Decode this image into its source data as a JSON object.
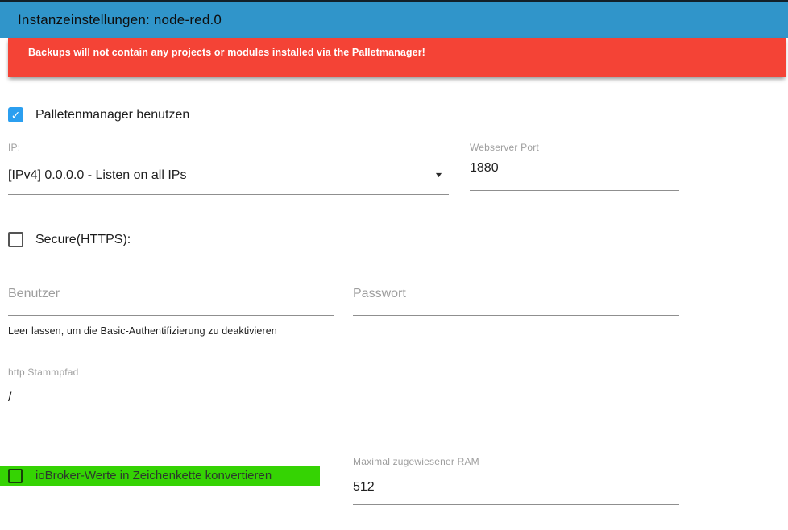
{
  "header": {
    "title": "Instanzeinstellungen: node-red.0"
  },
  "warning": {
    "text": "Backups will not contain any projects or modules installed via the Palletmanager!"
  },
  "form": {
    "palletmanager": {
      "label": "Palletenmanager benutzen",
      "checked": true
    },
    "ip": {
      "label": "IP:",
      "value": "[IPv4] 0.0.0.0 - Listen on all IPs"
    },
    "port": {
      "label": "Webserver Port",
      "value": "1880"
    },
    "secure": {
      "label": "Secure(HTTPS):",
      "checked": false
    },
    "user": {
      "placeholder": "Benutzer",
      "value": "",
      "helper": "Leer lassen, um die Basic-Authentifizierung zu deaktivieren"
    },
    "password": {
      "placeholder": "Passwort",
      "value": ""
    },
    "http_root": {
      "label": "http Stammpfad",
      "value": "/"
    },
    "convert_values": {
      "label": "ioBroker-Werte in Zeichenkette konvertieren",
      "checked": false
    },
    "ram": {
      "label": "Maximal zugewiesener RAM",
      "value": "512"
    }
  },
  "icons": {
    "checkmark": "✓",
    "dropdown_arrow": "▼"
  },
  "colors": {
    "header_blue": "#3095ca",
    "warning_red": "#f44336",
    "checkbox_blue": "#2b9ff0",
    "highlight_green": "#35d303"
  }
}
